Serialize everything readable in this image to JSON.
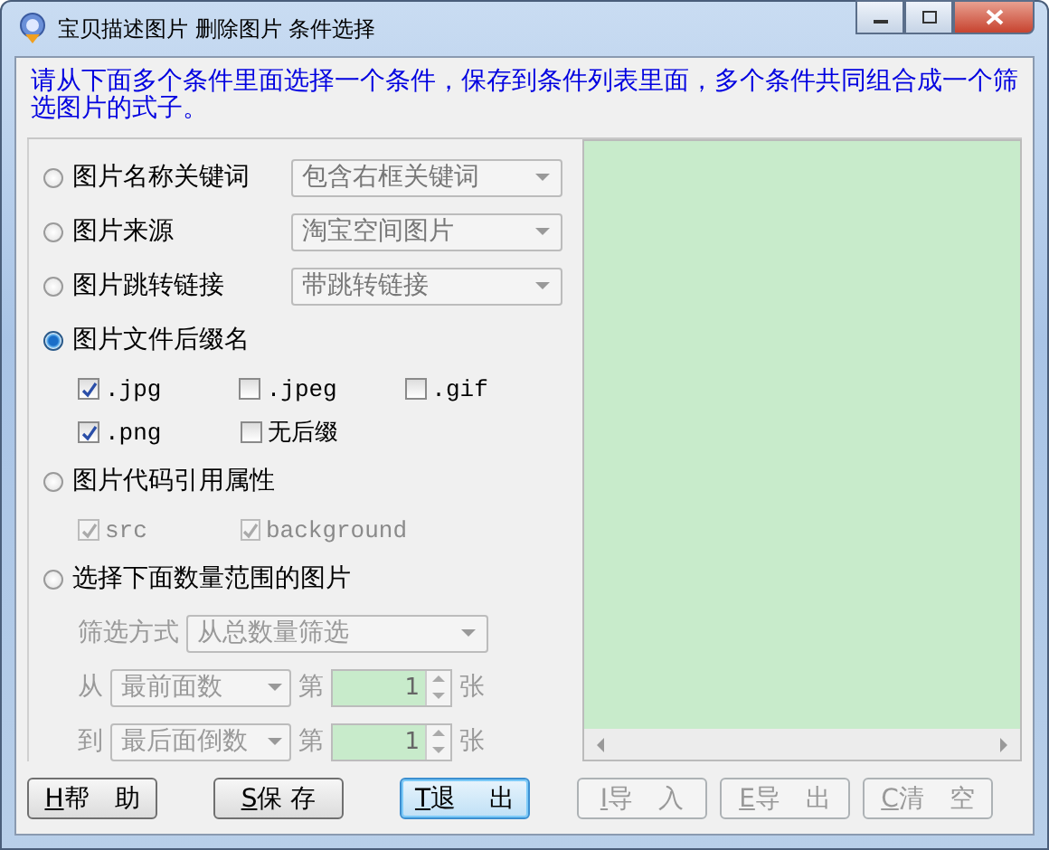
{
  "window": {
    "title": "宝贝描述图片 删除图片 条件选择"
  },
  "instruction": "请从下面多个条件里面选择一个条件，保存到条件列表里面，多个条件共同组合成一个筛选图片的式子。",
  "conditions": [
    {
      "kind": "dropdown",
      "label": "图片名称关键词",
      "selected": false,
      "dropdown": {
        "value": "包含右框关键词",
        "disabled": true
      }
    },
    {
      "kind": "dropdown",
      "label": "图片来源",
      "selected": false,
      "dropdown": {
        "value": "淘宝空间图片",
        "disabled": true
      }
    },
    {
      "kind": "dropdown",
      "label": "图片跳转链接",
      "selected": false,
      "dropdown": {
        "value": "带跳转链接",
        "disabled": true
      }
    },
    {
      "kind": "checkboxes",
      "label": "图片文件后缀名",
      "selected": true,
      "rows": [
        [
          {
            "label": ".jpg",
            "checked": true,
            "disabled": false
          },
          {
            "label": ".jpeg",
            "checked": false,
            "disabled": false
          },
          {
            "label": ".gif",
            "checked": false,
            "disabled": false
          }
        ],
        [
          {
            "label": ".png",
            "checked": true,
            "disabled": false
          },
          {
            "label": "无后缀",
            "checked": false,
            "disabled": false
          }
        ]
      ]
    },
    {
      "kind": "checkboxes",
      "label": "图片代码引用属性",
      "selected": false,
      "rows": [
        [
          {
            "label": "src",
            "checked": true,
            "disabled": true
          },
          {
            "label": "background",
            "checked": true,
            "disabled": true
          }
        ]
      ]
    },
    {
      "kind": "range",
      "label": "选择下面数量范围的图片",
      "selected": false,
      "disabled": true,
      "method": {
        "label": "筛选方式",
        "value": "从总数量筛选"
      },
      "bounds": [
        {
          "label": "从",
          "value": "最前面数",
          "ordinal": "第",
          "number": "1",
          "unit": "张"
        },
        {
          "label": "到",
          "value": "最后面倒数",
          "ordinal": "第",
          "number": "1",
          "unit": "张"
        }
      ]
    }
  ],
  "buttons": [
    {
      "key": "H",
      "label": "帮　助",
      "disabled": false,
      "default": false
    },
    {
      "key": "S",
      "label": "保 存",
      "disabled": false,
      "default": false
    },
    {
      "key": "T",
      "label": "退　 出",
      "disabled": false,
      "default": true
    },
    {
      "key": "I",
      "label": "导　入",
      "disabled": true,
      "default": false
    },
    {
      "key": "E",
      "label": "导　出",
      "disabled": true,
      "default": false
    },
    {
      "key": "C",
      "label": "清　空",
      "disabled": true,
      "default": false
    }
  ]
}
